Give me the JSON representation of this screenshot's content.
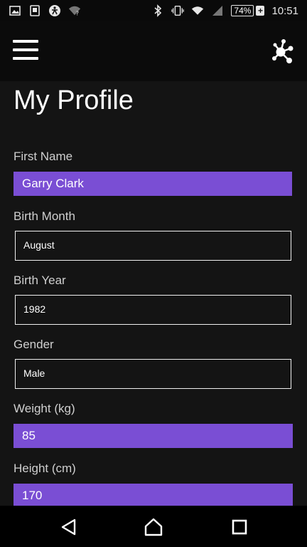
{
  "status": {
    "battery": "74%",
    "time": "10:51"
  },
  "page": {
    "title": "My Profile"
  },
  "fields": {
    "first_name": {
      "label": "First Name",
      "value": "Garry Clark"
    },
    "birth_month": {
      "label": "Birth Month",
      "value": "August"
    },
    "birth_year": {
      "label": "Birth Year",
      "value": "1982"
    },
    "gender": {
      "label": "Gender",
      "value": "Male"
    },
    "weight": {
      "label": "Weight (kg)",
      "value": "85"
    },
    "height": {
      "label": "Height (cm)",
      "value": "170"
    }
  },
  "colors": {
    "accent": "#7a4ed4",
    "background": "#141414",
    "app_bar": "#0b0b0b"
  },
  "icons": {
    "menu": "hamburger-icon",
    "hub": "molecule-hub-icon",
    "back": "back-triangle-icon",
    "home": "home-icon",
    "recents": "square-recents-icon"
  }
}
